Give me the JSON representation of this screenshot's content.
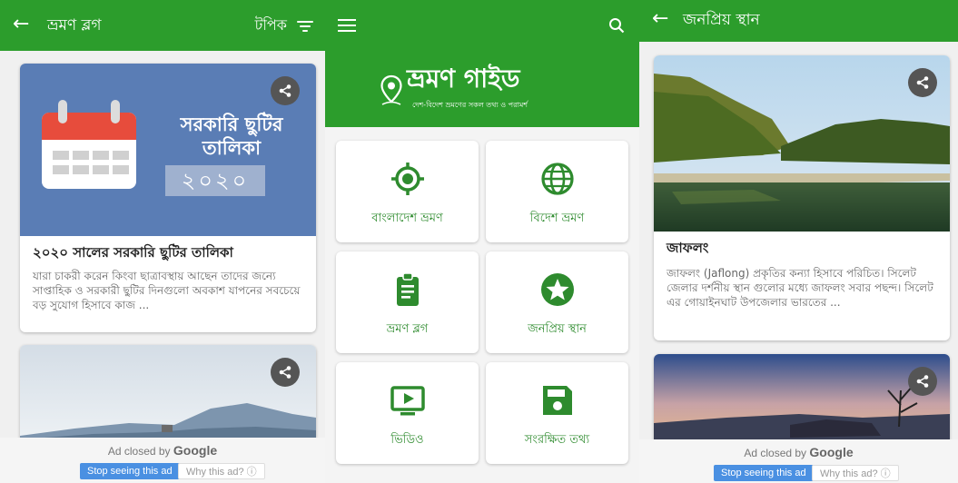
{
  "screens": {
    "blog": {
      "title": "ভ্রমণ ব্লগ",
      "topic_label": "টপিক",
      "cards": [
        {
          "image_heading": "সরকারি ছুটির তালিকা",
          "image_year": "২০২০",
          "title": "২০২০ সালের সরকারি ছুটির তালিকা",
          "description": "যারা চাকরী করেন কিংবা ছাত্রাবস্থায় আছেন তাদের জন্যে সাপ্তাহিক ও সরকারী ছুটির দিনগুলো অবকাশ যাপনের সবচেয়ে বড় সুযোগ হিসাবে কাজ ..."
        },
        {}
      ],
      "ad": {
        "closed_by": "Ad closed by",
        "google": "Google",
        "stop": "Stop seeing this ad",
        "why": "Why this ad? ⓘ"
      }
    },
    "home": {
      "app_title": "ভ্রমণ গাইড",
      "app_subtitle": "দেশ-বিদেশ ভ্রমণের সকল তথ্য ও পরামর্শ",
      "tiles": [
        {
          "label": "বাংলাদেশ ভ্রমণ",
          "icon": "target-icon"
        },
        {
          "label": "বিদেশ ভ্রমণ",
          "icon": "globe-icon"
        },
        {
          "label": "ভ্রমণ ব্লগ",
          "icon": "clipboard-icon"
        },
        {
          "label": "জনপ্রিয় স্থান",
          "icon": "star-icon"
        },
        {
          "label": "ভিডিও",
          "icon": "video-icon"
        },
        {
          "label": "সংরক্ষিত তথ্য",
          "icon": "save-icon"
        }
      ]
    },
    "places": {
      "title": "জনপ্রিয় স্থান",
      "cards": [
        {
          "title": "জাফলং",
          "description": "জাফলং (Jaflong) প্রকৃতির কন্যা হিসাবে পরিচিত। সিলেট জেলার দর্শনীয় স্থান গুলোর মধ্যে জাফলং সবার পছন্দ। সিলেট এর গোয়াইনঘাট উপজেলার ভারতের ..."
        },
        {}
      ],
      "ad": {
        "closed_by": "Ad closed by",
        "google": "Google",
        "stop": "Stop seeing this ad",
        "why": "Why this ad? ⓘ"
      }
    }
  },
  "colors": {
    "brand_green": "#2c9d2c",
    "tile_green": "#2e8b2e",
    "calendar_blue_bg": "#5a7db5",
    "calendar_red": "#e74c3c",
    "ad_blue": "#4a90e2"
  }
}
